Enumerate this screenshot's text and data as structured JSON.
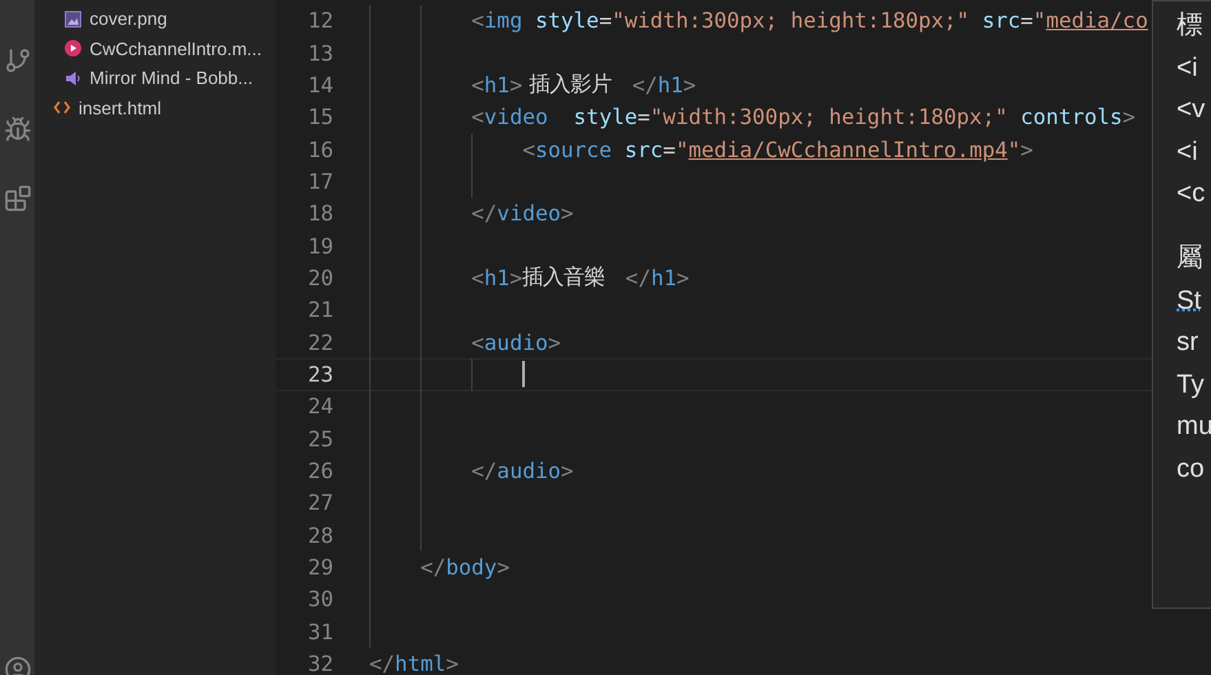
{
  "explorer": {
    "files": [
      {
        "name": "cover.png",
        "kind": "image",
        "nested": true
      },
      {
        "name": "CwCchannelIntro.m...",
        "kind": "video",
        "nested": true
      },
      {
        "name": "Mirror Mind - Bobb...",
        "kind": "audio",
        "nested": true
      },
      {
        "name": "insert.html",
        "kind": "html",
        "nested": false
      }
    ]
  },
  "editor": {
    "lines": [
      {
        "children": [
          {
            "children": [
              {
                "number": "12",
                "tokens": [
                  {
                    "kind": "bracket",
                    "text": "<"
                  },
                  {
                    "kind": "tag",
                    "text": "img"
                  },
                  {
                    "kind": "attr",
                    "text": " style"
                  },
                  {
                    "kind": "plain",
                    "text": "="
                  },
                  {
                    "kind": "string",
                    "text": "\"width:300px; height:180px;\""
                  },
                  {
                    "kind": "attr",
                    "text": " src"
                  },
                  {
                    "kind": "plain",
                    "text": "="
                  },
                  {
                    "kind": "string",
                    "text": "\""
                  },
                  {
                    "kind": "link",
                    "text": "media/co"
                  }
                ]
              },
              {
                "number": "13"
              },
              {
                "number": "14",
                "tokens": [
                  {
                    "kind": "bracket",
                    "text": "<"
                  },
                  {
                    "kind": "tag",
                    "text": "h1"
                  },
                  {
                    "kind": "bracket",
                    "text": ">"
                  },
                  {
                    "kind": "text",
                    "text": " 插入影片   "
                  },
                  {
                    "kind": "bracket",
                    "text": "</"
                  },
                  {
                    "kind": "tag",
                    "text": "h1"
                  },
                  {
                    "kind": "bracket",
                    "text": ">"
                  }
                ]
              },
              {
                "number": "15",
                "tokens": [
                  {
                    "kind": "bracket",
                    "text": "<"
                  },
                  {
                    "kind": "tag",
                    "text": "video"
                  },
                  {
                    "kind": "attr",
                    "text": "  style"
                  },
                  {
                    "kind": "plain",
                    "text": "="
                  },
                  {
                    "kind": "string",
                    "text": "\"width:300px; height:180px;\""
                  },
                  {
                    "kind": "attr",
                    "text": " controls"
                  },
                  {
                    "kind": "bracket",
                    "text": ">"
                  }
                ],
                "children": [
                  {
                    "number": "16",
                    "tokens": [
                      {
                        "kind": "bracket",
                        "text": "<"
                      },
                      {
                        "kind": "tag",
                        "text": "source"
                      },
                      {
                        "kind": "attr",
                        "text": " src"
                      },
                      {
                        "kind": "plain",
                        "text": "="
                      },
                      {
                        "kind": "string",
                        "text": "\""
                      },
                      {
                        "kind": "link",
                        "text": "media/CwCchannelIntro.mp4"
                      },
                      {
                        "kind": "string",
                        "text": "\""
                      },
                      {
                        "kind": "bracket",
                        "text": ">"
                      }
                    ]
                  },
                  {
                    "number": "17"
                  }
                ]
              },
              {
                "number": "18",
                "tokens": [
                  {
                    "kind": "bracket",
                    "text": "</"
                  },
                  {
                    "kind": "tag",
                    "text": "video"
                  },
                  {
                    "kind": "bracket",
                    "text": ">"
                  }
                ]
              },
              {
                "number": "19"
              },
              {
                "number": "20",
                "tokens": [
                  {
                    "kind": "bracket",
                    "text": "<"
                  },
                  {
                    "kind": "tag",
                    "text": "h1"
                  },
                  {
                    "kind": "bracket",
                    "text": ">"
                  },
                  {
                    "kind": "text",
                    "text": "插入音樂   "
                  },
                  {
                    "kind": "bracket",
                    "text": "</"
                  },
                  {
                    "kind": "tag",
                    "text": "h1"
                  },
                  {
                    "kind": "bracket",
                    "text": ">"
                  }
                ]
              },
              {
                "number": "21"
              },
              {
                "number": "22",
                "tokens": [
                  {
                    "kind": "bracket",
                    "text": "<"
                  },
                  {
                    "kind": "tag",
                    "text": "audio"
                  },
                  {
                    "kind": "bracket",
                    "text": ">"
                  }
                ],
                "children": [
                  {
                    "number": "23",
                    "current": true,
                    "cursor": true
                  }
                ]
              },
              {
                "number": "24"
              },
              {
                "number": "25"
              },
              {
                "number": "26",
                "tokens": [
                  {
                    "kind": "bracket",
                    "text": "</"
                  },
                  {
                    "kind": "tag",
                    "text": "audio"
                  },
                  {
                    "kind": "bracket",
                    "text": ">"
                  }
                ]
              },
              {
                "number": "27"
              },
              {
                "number": "28"
              }
            ]
          },
          {
            "number": "29",
            "tokens": [
              {
                "kind": "bracket",
                "text": "</"
              },
              {
                "kind": "tag",
                "text": "body"
              },
              {
                "kind": "bracket",
                "text": ">"
              }
            ]
          },
          {
            "number": "30"
          },
          {
            "number": "31"
          }
        ]
      },
      {
        "number": "32",
        "tokens": [
          {
            "kind": "bracket",
            "text": "</"
          },
          {
            "kind": "tag",
            "text": "html"
          },
          {
            "kind": "bracket",
            "text": ">"
          }
        ]
      }
    ]
  },
  "hover_panel": {
    "groups": [
      {
        "items": [
          {
            "text": "標",
            "underlined": false
          },
          {
            "text": "<i",
            "underlined": false
          },
          {
            "text": "<v",
            "underlined": false
          },
          {
            "text": "<i",
            "underlined": false
          },
          {
            "text": "<c",
            "underlined": false
          }
        ]
      },
      {
        "items": [
          {
            "text": "屬",
            "underlined": false
          },
          {
            "text": "St",
            "underlined": true
          },
          {
            "text": "sr",
            "underlined": false
          },
          {
            "text": "Ty",
            "underlined": false
          },
          {
            "text": "mu",
            "underlined": false
          },
          {
            "text": "co",
            "underlined": false
          }
        ]
      }
    ]
  }
}
